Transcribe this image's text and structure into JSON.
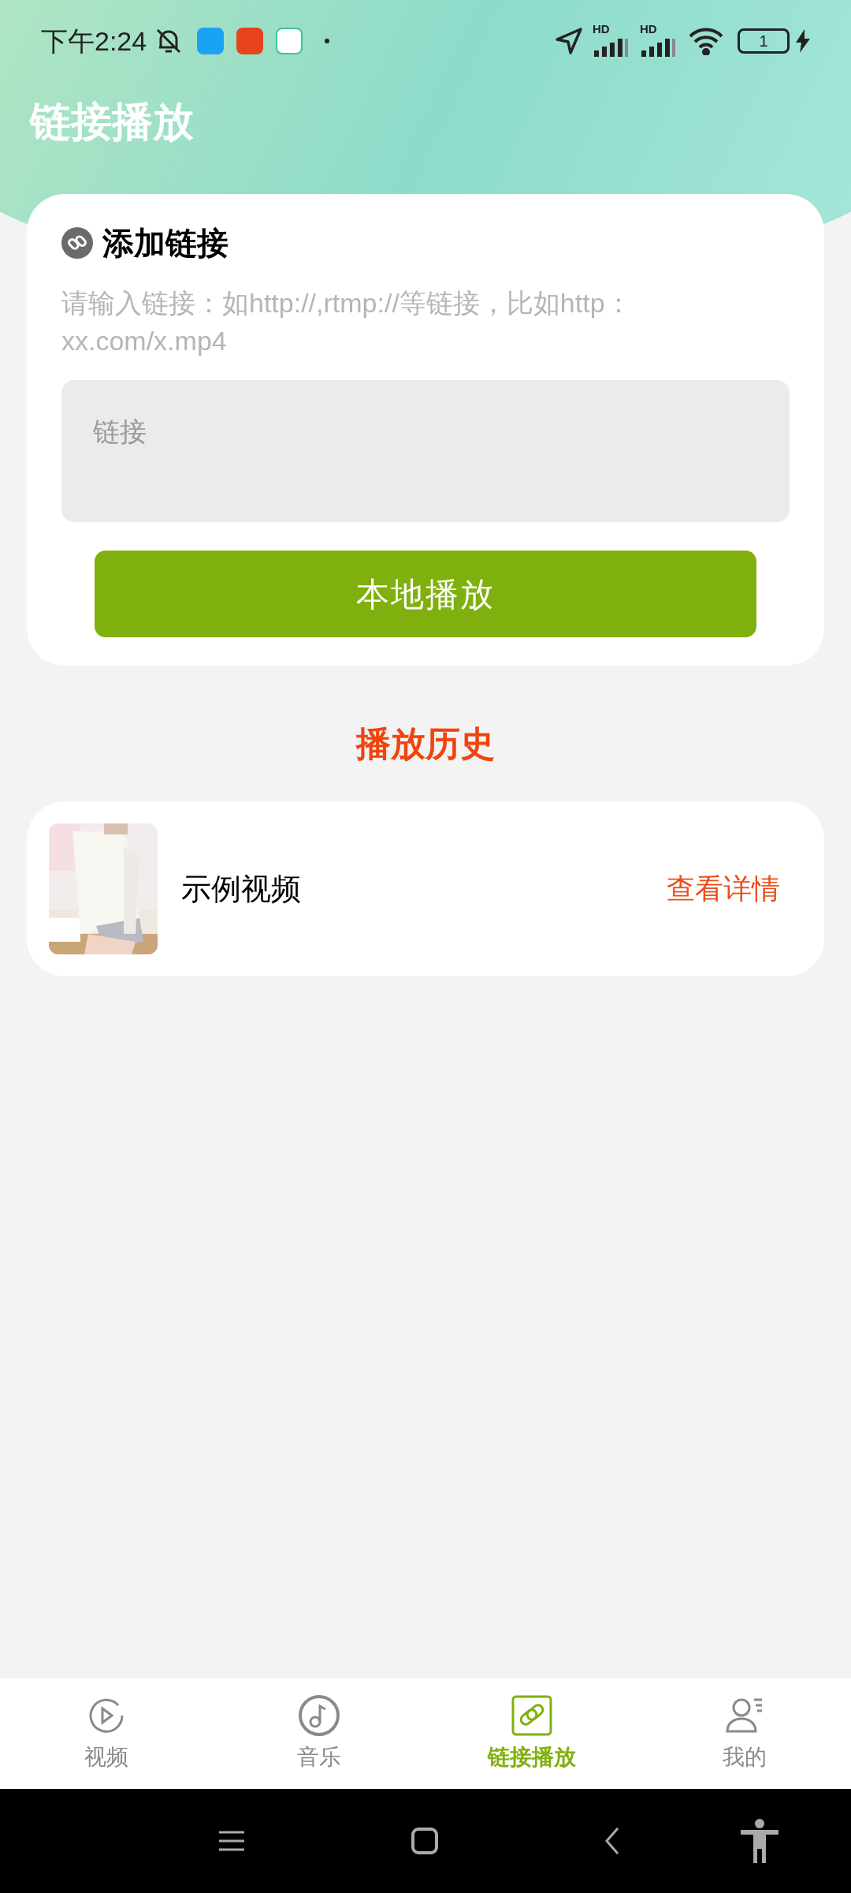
{
  "status_bar": {
    "time": "下午2:24",
    "signals": [
      "HD",
      "HD"
    ],
    "battery": "1"
  },
  "header": {
    "title": "链接播放"
  },
  "add_link": {
    "title": "添加链接",
    "hint": "请输入链接：如http://,rtmp://等链接，比如http：xx.com/x.mp4",
    "input": {
      "placeholder": "链接"
    },
    "button": "本地播放"
  },
  "history": {
    "title": "播放历史",
    "items": [
      {
        "kind": "picture",
        "title": "示例视频",
        "action": "查看详情"
      }
    ]
  },
  "tabs": [
    {
      "kind": "play",
      "label": "视频",
      "selected": false
    },
    {
      "kind": "music",
      "label": "音乐",
      "selected": false
    },
    {
      "kind": "link",
      "label": "链接播放",
      "selected": true
    },
    {
      "kind": "person",
      "label": "我的",
      "selected": false
    }
  ]
}
